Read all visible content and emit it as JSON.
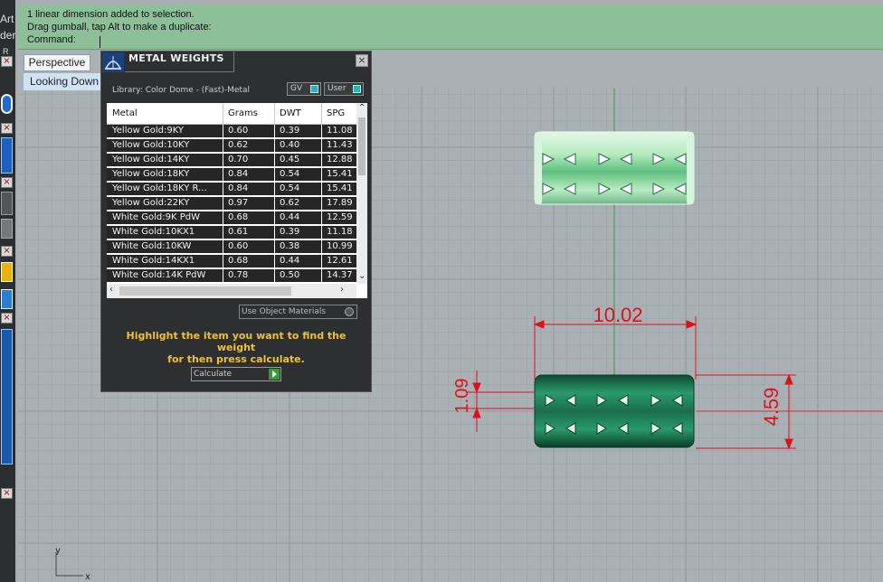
{
  "command_area": {
    "line1": "1 linear dimension added to selection.",
    "line2": "Drag gumball, tap Alt to make a duplicate:",
    "line3": "Command:"
  },
  "left_toolbar": {
    "label_art": "Art",
    "label_der": "der",
    "label_r": "R"
  },
  "viewport": {
    "tab_label": "Perspective",
    "view_label": "Looking Down",
    "axis_y": "y",
    "axis_x": "x",
    "dimension_width": "10.02",
    "dimension_height_left": "1.09",
    "dimension_height_right": "4.59",
    "colors": {
      "dimension": "#e0101a",
      "green_axis": "#3a9a3a",
      "light_object": "#a9e8b8",
      "dark_object": "#1f7a52"
    }
  },
  "panel": {
    "title": "METAL WEIGHTS",
    "close_label": "×",
    "library_label": "Library: Color Dome - (Fast)-Metal",
    "gv_label": "GV",
    "user_label": "User",
    "table": {
      "headers": [
        "Metal",
        "Grams",
        "DWT",
        "SPG"
      ],
      "rows": [
        [
          "Yellow Gold:9KY",
          "0.60",
          "0.39",
          "11.08"
        ],
        [
          "Yellow Gold:10KY",
          "0.62",
          "0.40",
          "11.43"
        ],
        [
          "Yellow Gold:14KY",
          "0.70",
          "0.45",
          "12.88"
        ],
        [
          "Yellow Gold:18KY",
          "0.84",
          "0.54",
          "15.41"
        ],
        [
          "Yellow Gold:18KY R...",
          "0.84",
          "0.54",
          "15.41"
        ],
        [
          "Yellow Gold:22KY",
          "0.97",
          "0.62",
          "17.89"
        ],
        [
          "White Gold:9K PdW",
          "0.68",
          "0.44",
          "12.59"
        ],
        [
          "White Gold:10KX1",
          "0.61",
          "0.39",
          "11.18"
        ],
        [
          "White Gold:10KW",
          "0.60",
          "0.38",
          "10.99"
        ],
        [
          "White Gold:14KX1",
          "0.68",
          "0.44",
          "12.61"
        ],
        [
          "White Gold:14K PdW",
          "0.78",
          "0.50",
          "14.37"
        ]
      ]
    },
    "use_object_materials": "Use Object Materials",
    "highlight_text_1": "Highlight the item you want to find the weight",
    "highlight_text_2": "for then press calculate.",
    "calculate_label": "Calculate",
    "highlight_color": "#f0c230"
  }
}
